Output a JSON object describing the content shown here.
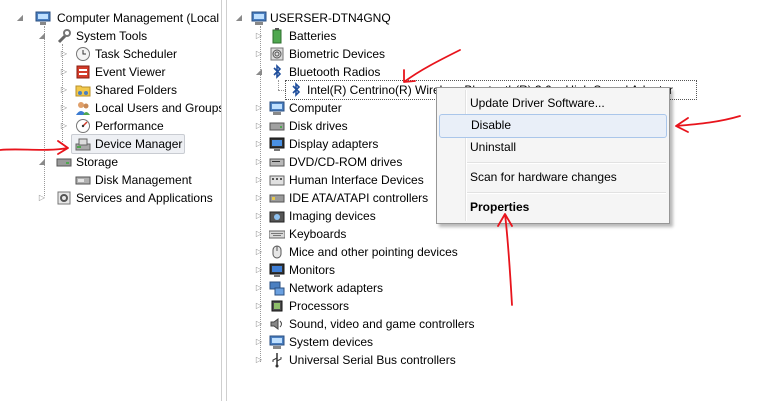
{
  "left_tree": {
    "root": "Computer Management (Local",
    "system_tools": "System Tools",
    "task_scheduler": "Task Scheduler",
    "event_viewer": "Event Viewer",
    "shared_folders": "Shared Folders",
    "local_users": "Local Users and Groups",
    "performance": "Performance",
    "device_manager": "Device Manager",
    "storage": "Storage",
    "disk_management": "Disk Management",
    "services": "Services and Applications"
  },
  "device_tree": {
    "computer_name": "USERSER-DTN4GNQ",
    "batteries": "Batteries",
    "biometric": "Biometric Devices",
    "bluetooth": "Bluetooth Radios",
    "bt_device": "Intel(R) Centrino(R) Wireless Bluetooth(R) 3.0 + High Speed Adapter",
    "computer": "Computer",
    "disk_drives": "Disk drives",
    "display": "Display adapters",
    "dvd": "DVD/CD-ROM drives",
    "hid": "Human Interface Devices",
    "ide": "IDE ATA/ATAPI controllers",
    "imaging": "Imaging devices",
    "keyboards": "Keyboards",
    "mice": "Mice and other pointing devices",
    "monitors": "Monitors",
    "network": "Network adapters",
    "processors": "Processors",
    "sound": "Sound, video and game controllers",
    "system_devices": "System devices",
    "usb": "Universal Serial Bus controllers"
  },
  "context_menu": {
    "update": "Update Driver Software...",
    "disable": "Disable",
    "uninstall": "Uninstall",
    "scan": "Scan for hardware changes",
    "properties": "Properties"
  },
  "colors": {
    "annotation": "#e8141c",
    "menu_highlight": "#e9eff8",
    "selection": "#eef0f4"
  }
}
